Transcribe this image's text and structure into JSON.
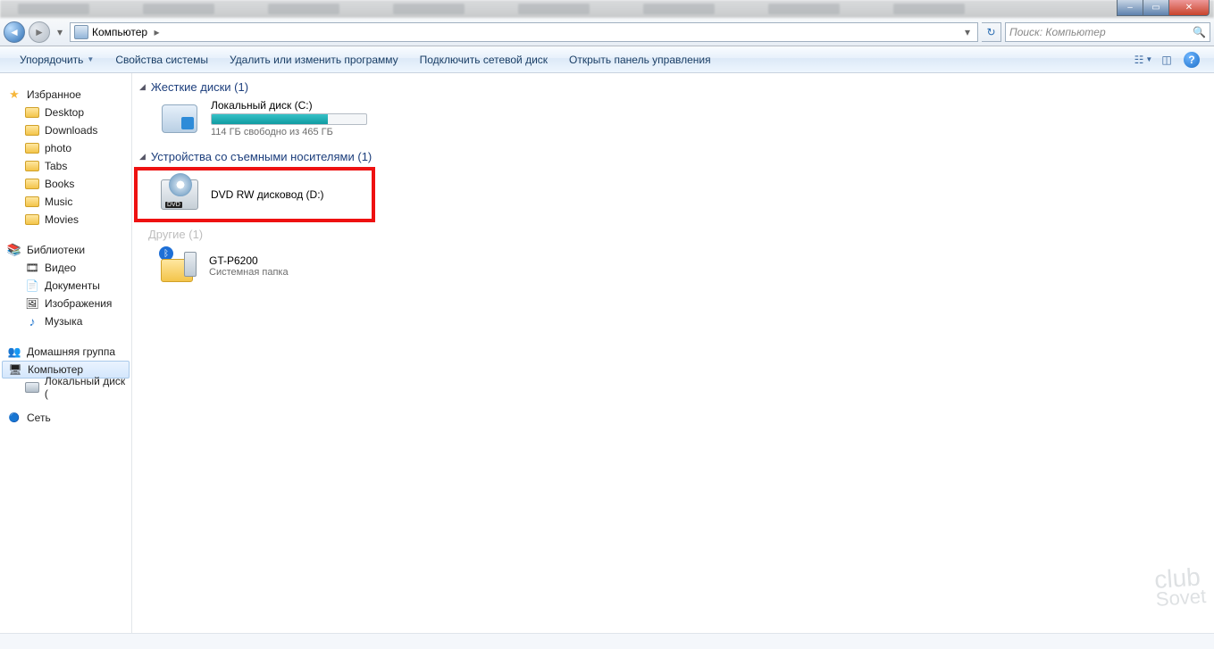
{
  "window_controls": {
    "min": "–",
    "max": "▭",
    "close": "✕"
  },
  "nav": {
    "back": "◄",
    "forward": "►",
    "drop": "▾",
    "refresh": "↻"
  },
  "breadcrumb": {
    "location": "Компьютер",
    "arrow": "▸"
  },
  "search": {
    "placeholder": "Поиск: Компьютер",
    "icon": "🔍"
  },
  "toolbar": {
    "organize": "Упорядочить",
    "properties": "Свойства системы",
    "uninstall": "Удалить или изменить программу",
    "map_drive": "Подключить сетевой диск",
    "control_panel": "Открыть панель управления"
  },
  "sidebar": {
    "favorites": "Избранное",
    "fav_items": [
      "Desktop",
      "Downloads",
      "photo",
      "Tabs",
      "Books",
      "Music",
      "Movies"
    ],
    "libraries": "Библиотеки",
    "lib_items": [
      "Видео",
      "Документы",
      "Изображения",
      "Музыка"
    ],
    "homegroup": "Домашняя группа",
    "computer": "Компьютер",
    "computer_items": [
      "Локальный диск ("
    ],
    "network": "Сеть"
  },
  "sections": {
    "hdd": "Жесткие диски (1)",
    "removable": "Устройства со съемными носителями (1)",
    "other": "Другие (1)"
  },
  "local_disk": {
    "title": "Локальный диск (C:)",
    "free": "114 ГБ свободно из 465 ГБ"
  },
  "dvd": {
    "title": "DVD RW дисковод (D:)"
  },
  "device": {
    "title": "GT-P6200",
    "sub": "Системная папка"
  },
  "watermark": {
    "line1": "club",
    "line2": "Sovet"
  }
}
